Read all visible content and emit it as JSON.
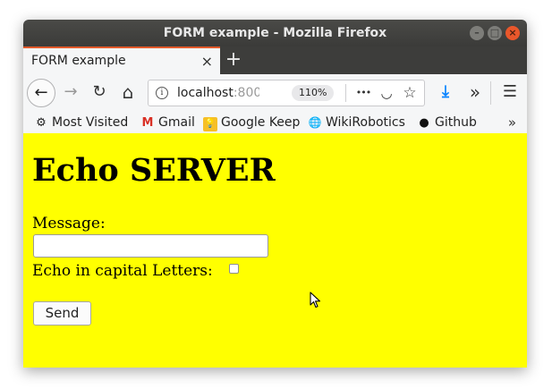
{
  "window": {
    "title": "FORM example - Mozilla Firefox",
    "minimize_glyph": "–",
    "maximize_glyph": "□",
    "close_glyph": "×"
  },
  "tabs": [
    {
      "label": "FORM example",
      "close_glyph": "×"
    }
  ],
  "new_tab_glyph": "+",
  "nav": {
    "back_glyph": "←",
    "forward_glyph": "→",
    "reload_glyph": "↻",
    "home_glyph": "⌂",
    "url_host": "localhost",
    "url_port": ":800",
    "zoom": "110%",
    "more_glyph": "•••",
    "pocket_glyph": "◡",
    "star_glyph": "☆",
    "download_glyph": "⤓",
    "overflow_glyph": "»",
    "menu_glyph": "☰"
  },
  "bookmarks": {
    "items": [
      {
        "label": "Most Visited",
        "icon": "gear-icon",
        "glyph": "⚙"
      },
      {
        "label": "Gmail",
        "icon": "gmail-icon",
        "glyph": "M"
      },
      {
        "label": "Google Keep",
        "icon": "keep-icon",
        "glyph": "💡"
      },
      {
        "label": "WikiRobotics",
        "icon": "globe-icon",
        "glyph": "🌐"
      },
      {
        "label": "Github",
        "icon": "github-icon",
        "glyph": "●"
      }
    ],
    "overflow_glyph": "»"
  },
  "page": {
    "background": "#ffff00",
    "heading": "Echo SERVER",
    "message_label": "Message:",
    "message_value": "",
    "caps_label": "Echo in capital Letters:",
    "caps_checked": false,
    "send_label": "Send"
  },
  "colors": {
    "titlebar": "#3b3b39",
    "tab_accent": "#e35a2b",
    "close_button": "#e9572b",
    "download_icon": "#0a84ff"
  }
}
